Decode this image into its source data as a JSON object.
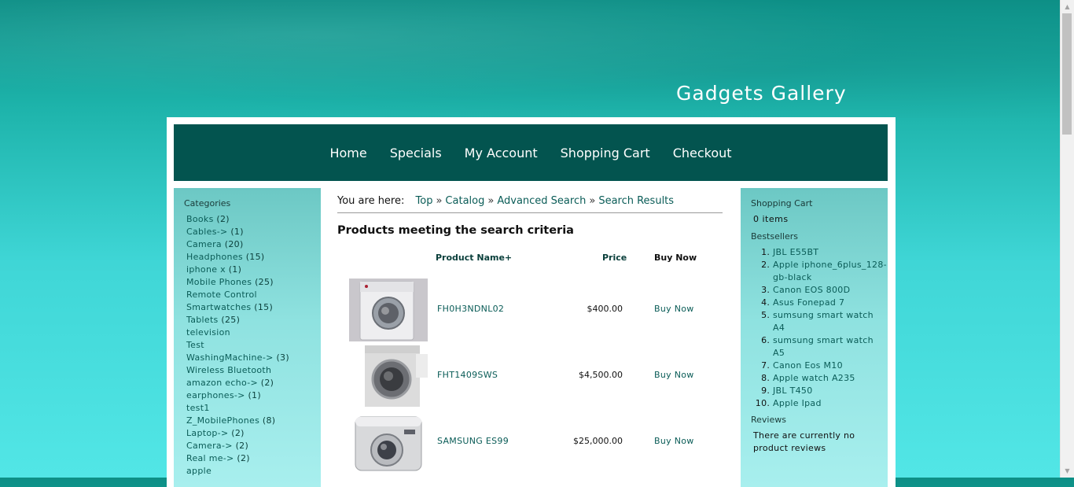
{
  "site": {
    "title": "Gadgets Gallery"
  },
  "nav": [
    {
      "label": "Home"
    },
    {
      "label": "Specials"
    },
    {
      "label": "My Account"
    },
    {
      "label": "Shopping Cart"
    },
    {
      "label": "Checkout"
    }
  ],
  "categories": {
    "heading": "Categories",
    "items": [
      {
        "name": "Books",
        "count": "(2)"
      },
      {
        "name": "Cables->",
        "count": "(1)"
      },
      {
        "name": "Camera",
        "count": "(20)"
      },
      {
        "name": "Headphones",
        "count": "(15)"
      },
      {
        "name": "iphone x",
        "count": "(1)"
      },
      {
        "name": "Mobile Phones",
        "count": "(25)"
      },
      {
        "name": "Remote Control",
        "count": ""
      },
      {
        "name": "Smartwatches",
        "count": "(15)"
      },
      {
        "name": "Tablets",
        "count": "(25)"
      },
      {
        "name": "television",
        "count": ""
      },
      {
        "name": "Test",
        "count": ""
      },
      {
        "name": "WashingMachine->",
        "count": "(3)"
      },
      {
        "name": "Wireless Bluetooth",
        "count": ""
      },
      {
        "name": "amazon echo->",
        "count": "(2)"
      },
      {
        "name": "earphones->",
        "count": "(1)"
      },
      {
        "name": "test1",
        "count": ""
      },
      {
        "name": "Z_MobilePhones",
        "count": "(8)"
      },
      {
        "name": "Laptop->",
        "count": "(2)"
      },
      {
        "name": "Camera->",
        "count": "(2)"
      },
      {
        "name": "Real me->",
        "count": "(2)"
      },
      {
        "name": "apple",
        "count": ""
      }
    ]
  },
  "breadcrumb": {
    "label": "You are here:",
    "items": [
      {
        "label": "Top"
      },
      {
        "label": "Catalog"
      },
      {
        "label": "Advanced Search"
      },
      {
        "label": "Search Results"
      }
    ],
    "separator": "»"
  },
  "main": {
    "heading": "Products meeting the search criteria",
    "columns": {
      "name": "Product Name+",
      "price": "Price",
      "buy": "Buy Now"
    },
    "products": [
      {
        "name": "FH0H3NDNL02",
        "price": "$400.00",
        "buy": "Buy Now",
        "icon": "washing-machine-icon"
      },
      {
        "name": "FHT1409SWS",
        "price": "$4,500.00",
        "buy": "Buy Now",
        "icon": "washing-machine-icon"
      },
      {
        "name": "SAMSUNG ES99",
        "price": "$25,000.00",
        "buy": "Buy Now",
        "icon": "camera-icon"
      }
    ]
  },
  "cart": {
    "heading": "Shopping Cart",
    "text": "0 items"
  },
  "bestsellers": {
    "heading": "Bestsellers",
    "items": [
      {
        "label": "JBL E55BT"
      },
      {
        "label": "Apple iphone_6plus_128-gb-black"
      },
      {
        "label": "Canon EOS 800D"
      },
      {
        "label": "Asus Fonepad 7"
      },
      {
        "label": "sumsung smart watch A4"
      },
      {
        "label": "sumsung smart watch A5"
      },
      {
        "label": "Canon Eos M10"
      },
      {
        "label": "Apple watch A235"
      },
      {
        "label": "JBL T450"
      },
      {
        "label": "Apple Ipad"
      }
    ]
  },
  "reviews": {
    "heading": "Reviews",
    "text": "There are currently no product reviews"
  }
}
